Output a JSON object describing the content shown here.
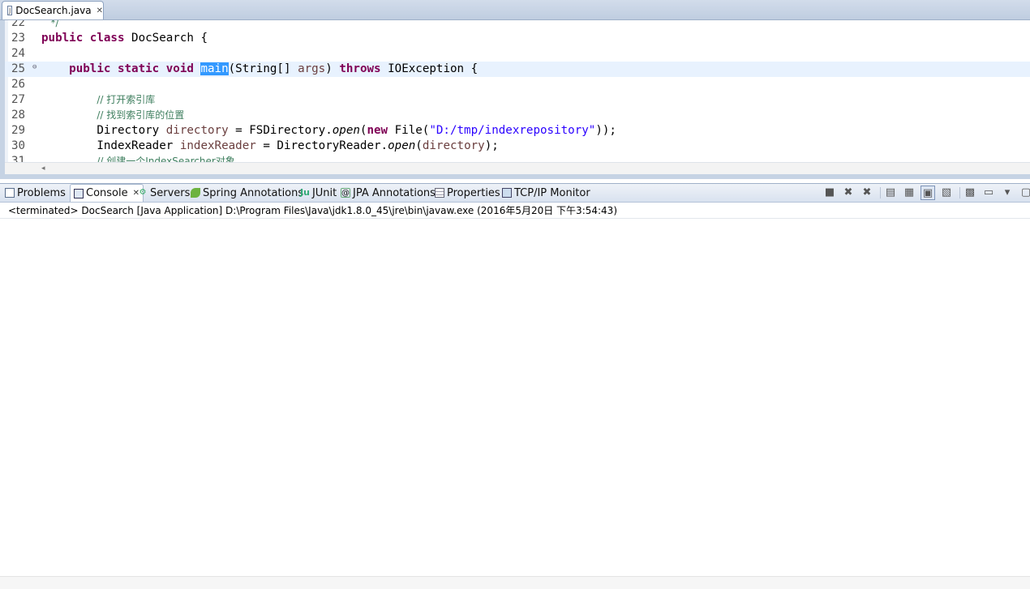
{
  "editor": {
    "tab": {
      "label": "DocSearch.java",
      "icon": "java-file-icon"
    },
    "lines": [
      {
        "num": "22",
        "tokens": [
          {
            "t": "   */",
            "c": "cm"
          }
        ]
      },
      {
        "num": "23",
        "tokens": [
          {
            "t": "public class",
            "c": "kw"
          },
          {
            "t": " DocSearch {",
            "c": ""
          }
        ]
      },
      {
        "num": "24",
        "tokens": []
      },
      {
        "num": "25",
        "current": true,
        "fold": "⊖",
        "tokens": [
          {
            "t": "    ",
            "c": ""
          },
          {
            "t": "public static void",
            "c": "kw"
          },
          {
            "t": " ",
            "c": ""
          },
          {
            "t": "main",
            "c": "sel"
          },
          {
            "t": "(String[] ",
            "c": ""
          },
          {
            "t": "args",
            "c": "var"
          },
          {
            "t": ") ",
            "c": ""
          },
          {
            "t": "throws",
            "c": "kw"
          },
          {
            "t": " IOException {",
            "c": ""
          }
        ]
      },
      {
        "num": "26",
        "tokens": []
      },
      {
        "num": "27",
        "tokens": [
          {
            "t": "        ",
            "c": ""
          },
          {
            "t": "// 打开索引库",
            "c": "cm"
          }
        ]
      },
      {
        "num": "28",
        "tokens": [
          {
            "t": "        ",
            "c": ""
          },
          {
            "t": "// 找到索引库的位置",
            "c": "cm"
          }
        ]
      },
      {
        "num": "29",
        "tokens": [
          {
            "t": "        Directory ",
            "c": ""
          },
          {
            "t": "directory",
            "c": "var"
          },
          {
            "t": " = FSDirectory.",
            "c": ""
          },
          {
            "t": "open",
            "c": "it"
          },
          {
            "t": "(",
            "c": ""
          },
          {
            "t": "new",
            "c": "kw"
          },
          {
            "t": " File(",
            "c": ""
          },
          {
            "t": "\"D:/tmp/indexrepository\"",
            "c": "str"
          },
          {
            "t": "));",
            "c": ""
          }
        ]
      },
      {
        "num": "30",
        "tokens": [
          {
            "t": "        IndexReader ",
            "c": ""
          },
          {
            "t": "indexReader",
            "c": "var"
          },
          {
            "t": " = DirectoryReader.",
            "c": ""
          },
          {
            "t": "open",
            "c": "it"
          },
          {
            "t": "(",
            "c": ""
          },
          {
            "t": "directory",
            "c": "var"
          },
          {
            "t": ");",
            "c": ""
          }
        ]
      },
      {
        "num": "31",
        "tokens": [
          {
            "t": "        ",
            "c": ""
          },
          {
            "t": "// 创建一个IndexSearcher对象",
            "c": "cm"
          }
        ]
      }
    ]
  },
  "views": {
    "tabs": [
      {
        "label": "Problems",
        "icon": "problems-icon",
        "cls": "ic-problems",
        "glyph": ""
      },
      {
        "label": "Console",
        "icon": "console-icon",
        "cls": "ic-console",
        "glyph": "",
        "active": true,
        "close": "✕"
      },
      {
        "label": "Servers",
        "icon": "servers-icon",
        "cls": "ic-servers",
        "glyph": "⚙"
      },
      {
        "label": "Spring Annotations",
        "icon": "spring-leaf-icon",
        "cls": "ic-spring",
        "glyph": ""
      },
      {
        "label": "JUnit",
        "icon": "junit-icon",
        "cls": "ic-junit",
        "glyph": "Ju"
      },
      {
        "label": "JPA Annotations",
        "icon": "jpa-icon",
        "cls": "ic-jpa",
        "glyph": "@"
      },
      {
        "label": "Properties",
        "icon": "properties-icon",
        "cls": "ic-properties",
        "glyph": ""
      },
      {
        "label": "TCP/IP Monitor",
        "icon": "tcp-monitor-icon",
        "cls": "ic-tcp",
        "glyph": ""
      }
    ],
    "toolbar": [
      {
        "name": "terminate-icon",
        "glyph": "■"
      },
      {
        "name": "remove-launch-icon",
        "glyph": "✖"
      },
      {
        "name": "remove-all-terminated-icon",
        "glyph": "✖"
      },
      {
        "sep": true
      },
      {
        "name": "clear-console-icon",
        "glyph": "▤"
      },
      {
        "name": "scroll-lock-icon",
        "glyph": "▦"
      },
      {
        "name": "show-on-output-icon",
        "glyph": "▣",
        "pressed": true
      },
      {
        "name": "show-on-error-icon",
        "glyph": "▧"
      },
      {
        "sep": true
      },
      {
        "name": "pin-console-icon",
        "glyph": "▩"
      },
      {
        "name": "display-selected-console-icon",
        "glyph": "▭"
      },
      {
        "name": "console-menu-chevron-icon",
        "glyph": "▾"
      },
      {
        "name": "new-console-icon",
        "glyph": "▢"
      }
    ],
    "console_header": "<terminated> DocSearch [Java Application] D:\\Program Files\\Java\\jdk1.8.0_45\\jre\\bin\\javaw.exe (2016年5月20日 下午3:54:43)"
  }
}
